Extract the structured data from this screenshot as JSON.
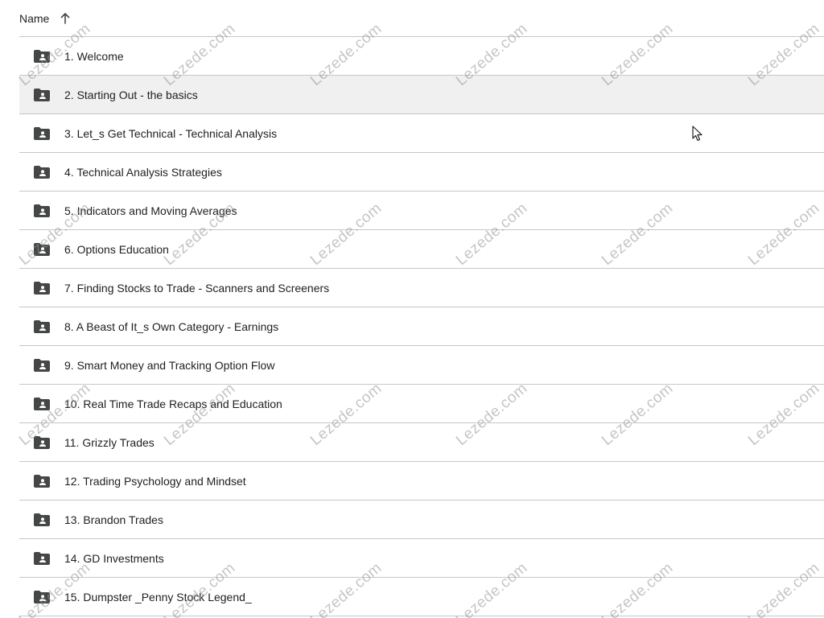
{
  "header": {
    "name_label": "Name",
    "sort_direction_icon": "arrow-up-icon"
  },
  "rows": [
    {
      "label": "1. Welcome",
      "icon": "shared-folder-icon"
    },
    {
      "label": "2. Starting Out - the basics",
      "icon": "shared-folder-icon",
      "selected": true
    },
    {
      "label": "3. Let_s Get Technical - Technical Analysis",
      "icon": "shared-folder-icon"
    },
    {
      "label": "4. Technical Analysis Strategies",
      "icon": "shared-folder-icon"
    },
    {
      "label": "5. Indicators and Moving Averages",
      "icon": "shared-folder-icon"
    },
    {
      "label": "6. Options Education",
      "icon": "shared-folder-icon"
    },
    {
      "label": "7. Finding Stocks to Trade - Scanners and Screeners",
      "icon": "shared-folder-icon"
    },
    {
      "label": "8. A Beast of It_s Own Category - Earnings",
      "icon": "shared-folder-icon"
    },
    {
      "label": "9. Smart Money and Tracking Option Flow",
      "icon": "shared-folder-icon"
    },
    {
      "label": "10. Real Time Trade Recaps and Education",
      "icon": "shared-folder-icon"
    },
    {
      "label": "11. Grizzly Trades",
      "icon": "shared-folder-icon"
    },
    {
      "label": "12. Trading Psychology and Mindset",
      "icon": "shared-folder-icon"
    },
    {
      "label": "13. Brandon Trades",
      "icon": "shared-folder-icon"
    },
    {
      "label": "14. GD Investments",
      "icon": "shared-folder-icon"
    },
    {
      "label": "15. Dumpster _Penny Stock Legend_",
      "icon": "shared-folder-icon"
    }
  ],
  "watermark": {
    "text": "Lezede.com"
  },
  "colors": {
    "divider": "#c7c7c7",
    "selected_row": "#f0f0f0",
    "icon": "#444746",
    "text": "#1f1f1f"
  }
}
